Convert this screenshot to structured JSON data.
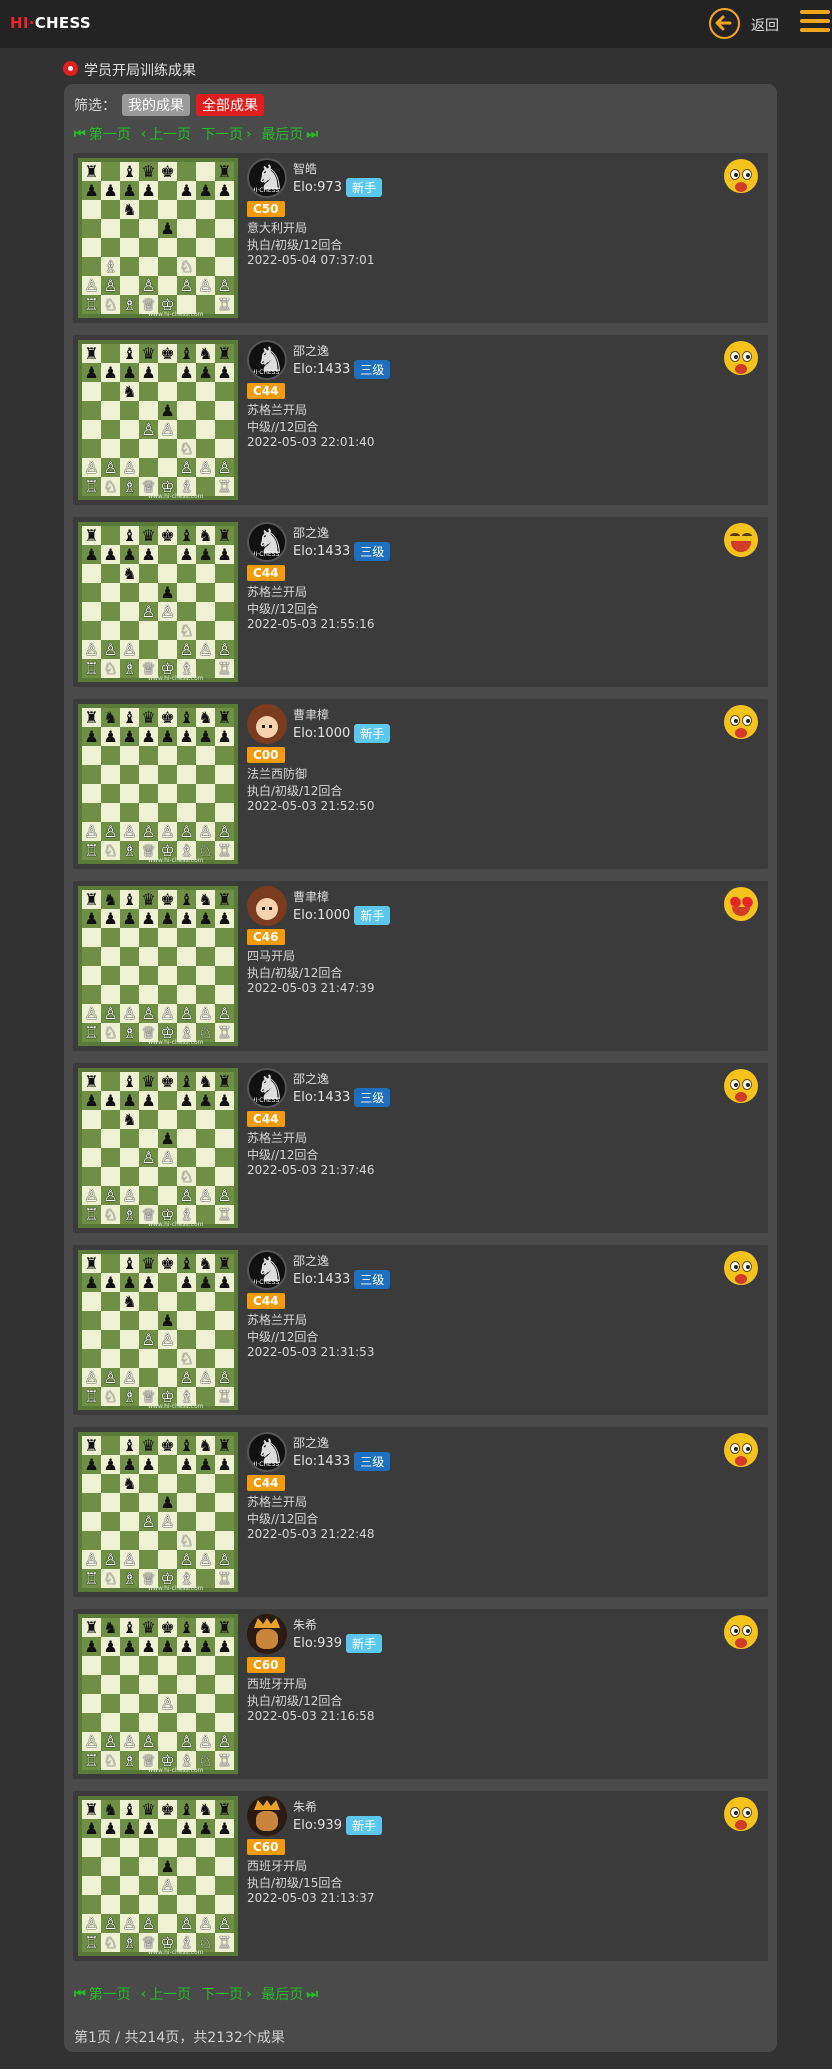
{
  "header": {
    "logo_hi": "HI·",
    "logo_chess": "CHESS",
    "back_label": "返回"
  },
  "section_title": "学员开局训练成果",
  "filter": {
    "label": "筛选：",
    "options": [
      "我的成果",
      "全部成果"
    ]
  },
  "pager": {
    "first": "第一页",
    "prev": "上一页",
    "next": "下一页",
    "last": "最后页"
  },
  "board_url": "www.hi-chess.com",
  "records": [
    {
      "name": "智皓",
      "elo": "Elo:973",
      "rank": "新手",
      "rank_color": "cyan",
      "eco": "C50",
      "opening": "意大利开局",
      "detail": "执白/初级/12回合",
      "time": "2022-05-04 07:37:01",
      "avatar": "knight",
      "emoji": "neutral",
      "board": "italian"
    },
    {
      "name": "邵之逸",
      "elo": "Elo:1433",
      "rank": "三级",
      "rank_color": "blue",
      "eco": "C44",
      "opening": "苏格兰开局",
      "detail": "中级//12回合",
      "time": "2022-05-03 22:01:40",
      "avatar": "knight",
      "emoji": "neutral",
      "board": "scotch"
    },
    {
      "name": "邵之逸",
      "elo": "Elo:1433",
      "rank": "三级",
      "rank_color": "blue",
      "eco": "C44",
      "opening": "苏格兰开局",
      "detail": "中级//12回合",
      "time": "2022-05-03 21:55:16",
      "avatar": "knight",
      "emoji": "laugh",
      "board": "scotch"
    },
    {
      "name": "曹聿樟",
      "elo": "Elo:1000",
      "rank": "新手",
      "rank_color": "cyan",
      "eco": "C00",
      "opening": "法兰西防御",
      "detail": "执白/初级/12回合",
      "time": "2022-05-03 21:52:50",
      "avatar": "girl",
      "emoji": "neutral",
      "board": "start"
    },
    {
      "name": "曹聿樟",
      "elo": "Elo:1000",
      "rank": "新手",
      "rank_color": "cyan",
      "eco": "C46",
      "opening": "四马开局",
      "detail": "执白/初级/12回合",
      "time": "2022-05-03 21:47:39",
      "avatar": "girl",
      "emoji": "hearts",
      "board": "start"
    },
    {
      "name": "邵之逸",
      "elo": "Elo:1433",
      "rank": "三级",
      "rank_color": "blue",
      "eco": "C44",
      "opening": "苏格兰开局",
      "detail": "中级//12回合",
      "time": "2022-05-03 21:37:46",
      "avatar": "knight",
      "emoji": "neutral",
      "board": "scotch"
    },
    {
      "name": "邵之逸",
      "elo": "Elo:1433",
      "rank": "三级",
      "rank_color": "blue",
      "eco": "C44",
      "opening": "苏格兰开局",
      "detail": "中级//12回合",
      "time": "2022-05-03 21:31:53",
      "avatar": "knight",
      "emoji": "neutral",
      "board": "scotch"
    },
    {
      "name": "邵之逸",
      "elo": "Elo:1433",
      "rank": "三级",
      "rank_color": "blue",
      "eco": "C44",
      "opening": "苏格兰开局",
      "detail": "中级//12回合",
      "time": "2022-05-03 21:22:48",
      "avatar": "knight",
      "emoji": "neutral",
      "board": "scotch"
    },
    {
      "name": "朱希",
      "elo": "Elo:939",
      "rank": "新手",
      "rank_color": "cyan",
      "eco": "C60",
      "opening": "西班牙开局",
      "detail": "执白/初级/12回合",
      "time": "2022-05-03 21:16:58",
      "avatar": "king",
      "emoji": "neutral",
      "board": "e4"
    },
    {
      "name": "朱希",
      "elo": "Elo:939",
      "rank": "新手",
      "rank_color": "cyan",
      "eco": "C60",
      "opening": "西班牙开局",
      "detail": "执白/初级/15回合",
      "time": "2022-05-03 21:13:37",
      "avatar": "king",
      "emoji": "neutral",
      "board": "e4e5"
    }
  ],
  "footer": "第1页 / 共214页，共2132个成果"
}
